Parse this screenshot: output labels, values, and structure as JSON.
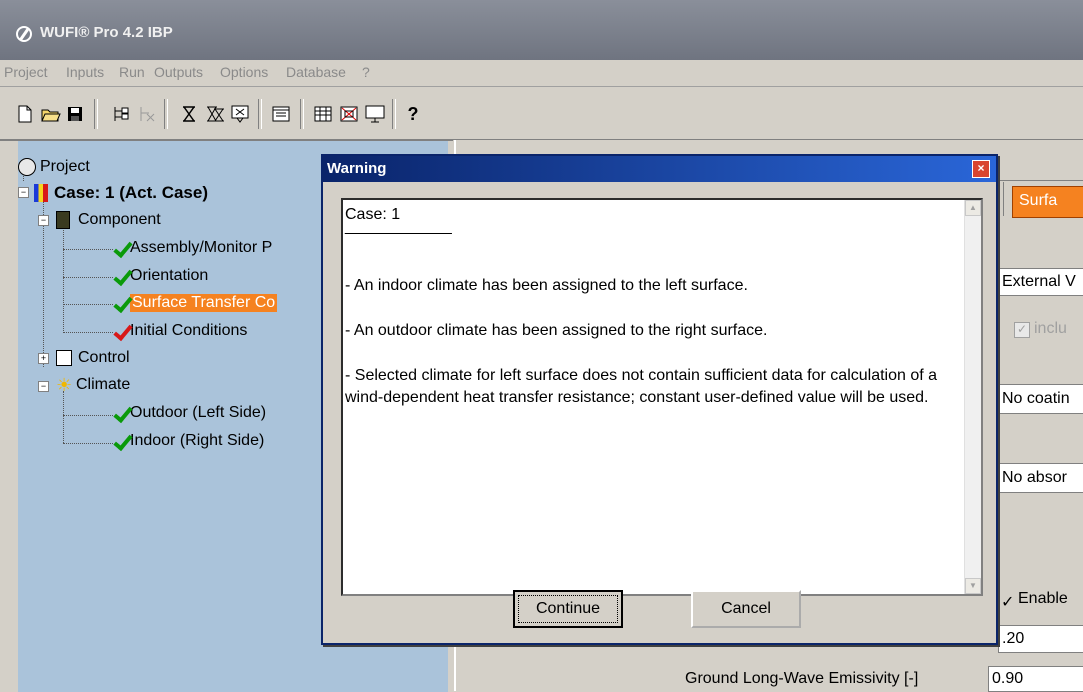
{
  "window": {
    "title": "WUFI® Pro 4.2 IBP"
  },
  "menu": [
    "Project",
    "Inputs",
    "Run",
    "Outputs",
    "Options",
    "Database",
    "?"
  ],
  "toolbar": {
    "help_label": "?"
  },
  "tree": {
    "project": "Project",
    "case": "Case: 1  (Act. Case)",
    "component": "Component",
    "assembly": "Assembly/Monitor P",
    "orientation": "Orientation",
    "surface": "Surface Transfer Co",
    "initial": "Initial Conditions",
    "control": "Control",
    "climate": "Climate",
    "outdoor": "Outdoor (Left Side)",
    "indoor": "Indoor (Right Side)"
  },
  "right_panel": {
    "tab_label": "Surfa",
    "external_field": "External V",
    "include_label": "inclu",
    "coating_field": "No coatin",
    "absorb_field": "No absor",
    "enable_label": "Enable",
    "value_field": ".20",
    "ground_label": "Ground Long-Wave Emissivity [-]",
    "ground_value": "0.90"
  },
  "dialog": {
    "title": "Warning",
    "close_label": "×",
    "lines": {
      "case": "Case: 1",
      "rule": "____________",
      "l1": "- An indoor climate has been assigned to the left surface.",
      "l2": "- An outdoor climate has been assigned to the right surface.",
      "l3": "- Selected climate for left surface does not contain sufficient data for calculation of a wind-dependent heat transfer resistance; constant user-defined value will be used."
    },
    "continue_label": "Continue",
    "cancel_label": "Cancel"
  },
  "colors": {
    "tree_bg": "#aac3da",
    "highlight": "#f58220",
    "check_green": "#0a9a0a",
    "check_red": "#d81818"
  }
}
